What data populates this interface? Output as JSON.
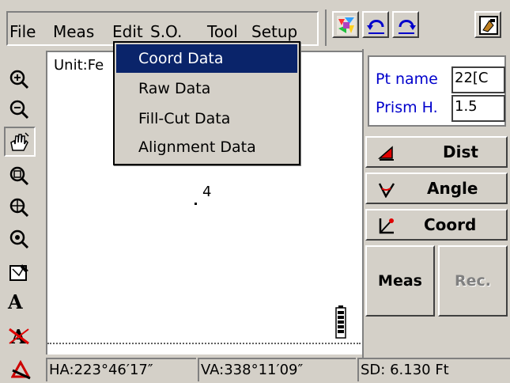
{
  "menu": {
    "items": [
      "File",
      "Meas",
      "Edit",
      "S.O.",
      "Tool",
      "Setup"
    ]
  },
  "toolbar": {
    "icons": [
      "palette-icon",
      "undo-icon",
      "redo-icon",
      "exit-icon"
    ]
  },
  "left_tools": [
    "zoom-in-icon",
    "zoom-out-icon",
    "pan-hand-icon",
    "zoom-window-icon",
    "zoom-all-icon",
    "zoom-center-icon",
    "edit-layer-icon",
    "text-icon",
    "no-text-icon"
  ],
  "canvas": {
    "unit_label": "Unit:Fe",
    "point_label": "4"
  },
  "dropdown": {
    "items": [
      "Coord Data",
      "Raw Data",
      "Fill-Cut Data",
      "Alignment Data"
    ],
    "selected_index": 0
  },
  "right_panel": {
    "pt_name_label": "Pt name",
    "pt_name_value": "22[C",
    "prism_label": "Prism H.",
    "prism_value": "1.5",
    "mode_buttons": [
      "Dist",
      "Angle",
      "Coord"
    ],
    "meas_button": "Meas",
    "rec_button": "Rec."
  },
  "status": {
    "ha": "HA:223°46′17″",
    "va": "VA:338°11′09″",
    "sd": "SD:   6.130 Ft"
  },
  "colors": {
    "menu_highlight": "#0a246a",
    "field_label": "#0000cc",
    "face": "#d4d0c8"
  }
}
